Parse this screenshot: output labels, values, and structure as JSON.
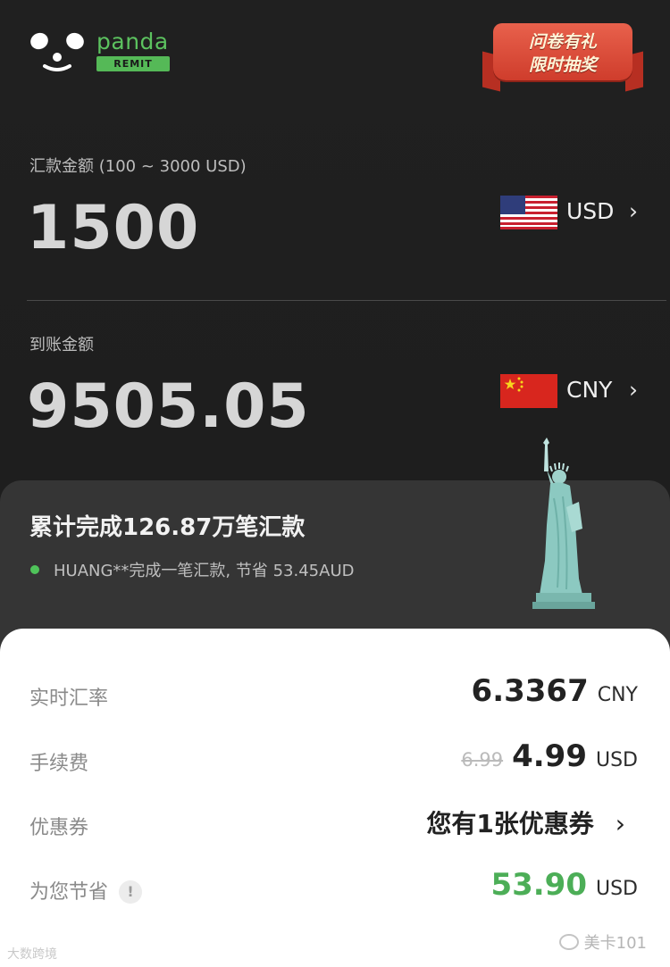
{
  "header": {
    "brand_name": "panda",
    "brand_tag": "REMIT",
    "promo_line1": "问卷有礼",
    "promo_line2": "限时抽奖"
  },
  "send": {
    "label": "汇款金额 (100 ~ 3000 USD)",
    "amount": "1500",
    "currency": "USD"
  },
  "receive": {
    "label": "到账金额",
    "amount": "9505.05",
    "currency": "CNY"
  },
  "stats": {
    "title": "累计完成126.87万笔汇款",
    "live_feed": "HUANG**完成一笔汇款, 节省 53.45AUD"
  },
  "details": {
    "rate_label": "实时汇率",
    "rate_value": "6.3367",
    "rate_unit": "CNY",
    "fee_label": "手续费",
    "fee_original": "6.99",
    "fee_value": "4.99",
    "fee_unit": "USD",
    "coupon_label": "优惠券",
    "coupon_value": "您有1张优惠券",
    "savings_label": "为您节省",
    "savings_value": "53.90",
    "savings_unit": "USD",
    "help_icon": "!"
  },
  "watermarks": {
    "left": "大数跨境",
    "right": "美卡101"
  },
  "colors": {
    "brand_green": "#5cc25f",
    "savings_green": "#4cae57",
    "promo_red": "#d9472f",
    "background": "#1d1d1d",
    "sheet": "#ffffff"
  },
  "icons": [
    "panda-logo-icon",
    "us-flag-icon",
    "cn-flag-icon",
    "chevron-right-icon",
    "info-icon",
    "statue-of-liberty-icon",
    "wechat-icon"
  ]
}
